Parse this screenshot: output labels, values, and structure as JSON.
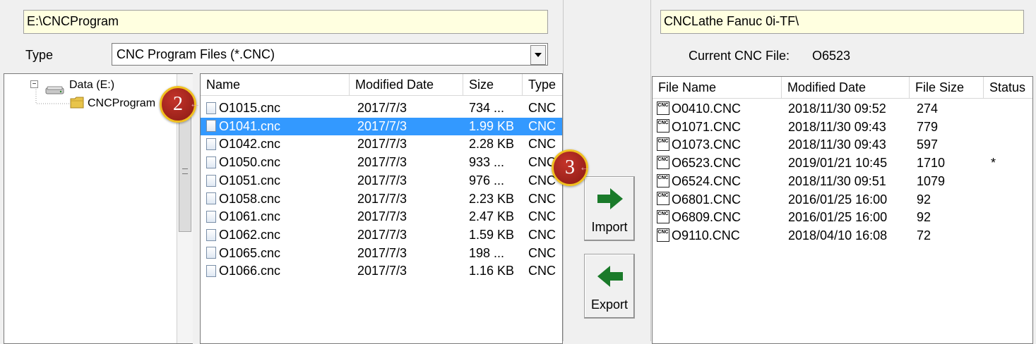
{
  "left": {
    "path": "E:\\CNCProgram",
    "type_label": "Type",
    "type_value": "CNC Program Files (*.CNC)",
    "tree": {
      "drive_label": "Data (E:)",
      "folder_label": "CNCProgram"
    },
    "columns": [
      "Name",
      "Modified Date",
      "Size",
      "Type"
    ],
    "files": [
      {
        "name": "O1015.cnc",
        "date": "2017/7/3",
        "size": "734 ...",
        "type": "CNC"
      },
      {
        "name": "O1041.cnc",
        "date": "2017/7/3",
        "size": "1.99 KB",
        "type": "CNC",
        "selected": true
      },
      {
        "name": "O1042.cnc",
        "date": "2017/7/3",
        "size": "2.28 KB",
        "type": "CNC"
      },
      {
        "name": "O1050.cnc",
        "date": "2017/7/3",
        "size": "933 ...",
        "type": "CNC"
      },
      {
        "name": "O1051.cnc",
        "date": "2017/7/3",
        "size": "976 ...",
        "type": "CNC"
      },
      {
        "name": "O1058.cnc",
        "date": "2017/7/3",
        "size": "2.23 KB",
        "type": "CNC"
      },
      {
        "name": "O1061.cnc",
        "date": "2017/7/3",
        "size": "2.47 KB",
        "type": "CNC"
      },
      {
        "name": "O1062.cnc",
        "date": "2017/7/3",
        "size": "1.59 KB",
        "type": "CNC"
      },
      {
        "name": "O1065.cnc",
        "date": "2017/7/3",
        "size": "198 ...",
        "type": "CNC"
      },
      {
        "name": "O1066.cnc",
        "date": "2017/7/3",
        "size": "1.16 KB",
        "type": "CNC"
      }
    ]
  },
  "middle": {
    "import_label": "Import",
    "export_label": "Export",
    "arrow_color": "#1a7a2a"
  },
  "right": {
    "path": "CNCLathe Fanuc 0i-TF\\",
    "current_label": "Current CNC File:",
    "current_value": "O6523",
    "columns": [
      "File Name",
      "Modified Date",
      "File Size",
      "Status"
    ],
    "icon_text": "CNC",
    "files": [
      {
        "name": "O0410.CNC",
        "date": "2018/11/30 09:52",
        "size": "274",
        "status": ""
      },
      {
        "name": "O1071.CNC",
        "date": "2018/11/30 09:43",
        "size": "779",
        "status": ""
      },
      {
        "name": "O1073.CNC",
        "date": "2018/11/30 09:43",
        "size": "597",
        "status": ""
      },
      {
        "name": "O6523.CNC",
        "date": "2019/01/21 10:45",
        "size": "1710",
        "status": "*"
      },
      {
        "name": "O6524.CNC",
        "date": "2018/11/30 09:51",
        "size": "1079",
        "status": ""
      },
      {
        "name": "O6801.CNC",
        "date": "2016/01/25 16:00",
        "size": "92",
        "status": ""
      },
      {
        "name": "O6809.CNC",
        "date": "2016/01/25 16:00",
        "size": "92",
        "status": ""
      },
      {
        "name": "O9110.CNC",
        "date": "2018/04/10 16:08",
        "size": "72",
        "status": ""
      }
    ]
  },
  "badges": {
    "step2": "2",
    "step3": "3"
  },
  "colors": {
    "selection": "#3399ff",
    "path_bg": "#ffffe0",
    "badge": "#a0231b",
    "badge_border": "#f0c020"
  }
}
